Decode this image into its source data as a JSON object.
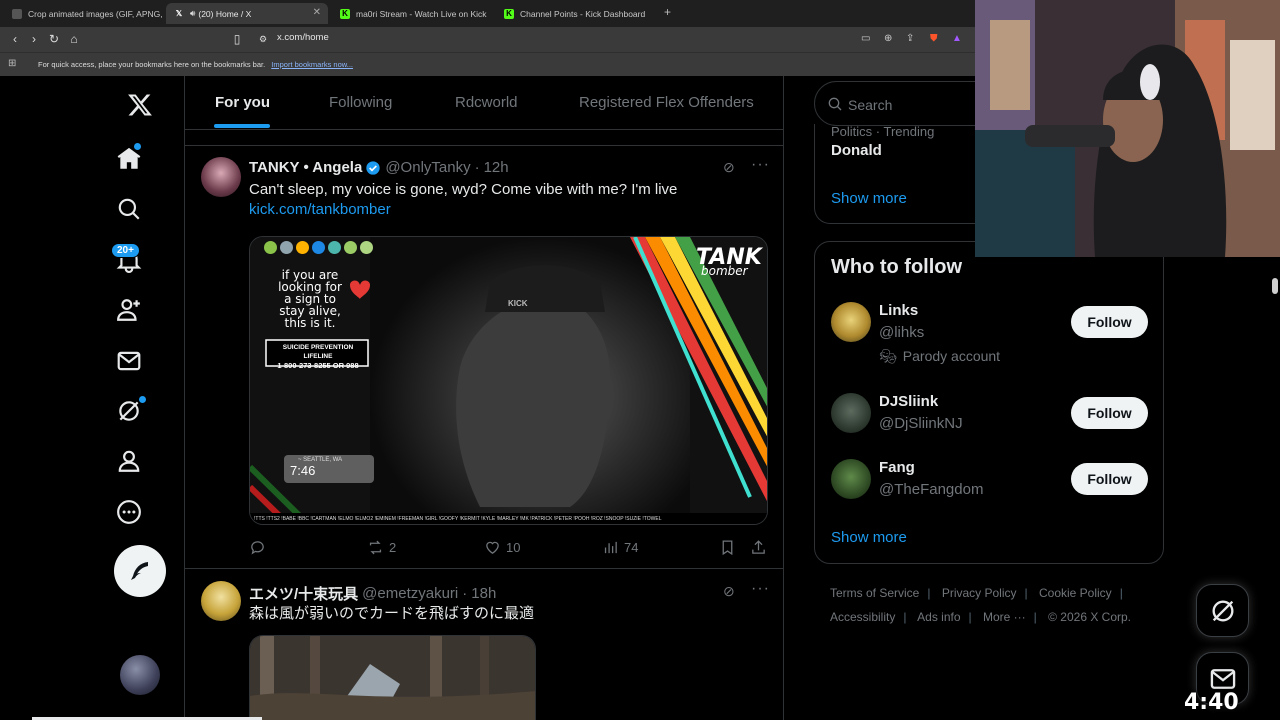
{
  "browser": {
    "tabs": [
      {
        "title": "Crop animated images (GIF, APNG, W",
        "icon": "crop-favicon"
      },
      {
        "title": "(20) Home / X",
        "icon": "x-favicon",
        "active": true
      },
      {
        "title": "ma0ri Stream - Watch Live on Kick",
        "icon": "kick-favicon"
      },
      {
        "title": "Channel Points - Kick Dashboard",
        "icon": "kick-favicon"
      }
    ],
    "url": "x.com/home",
    "bookmarks_text": "For quick access, place your bookmarks here on the bookmarks bar.",
    "bookmarks_link": "Import bookmarks now..."
  },
  "nav": {
    "notifications_badge": "20+"
  },
  "feed_tabs": [
    "For you",
    "Following",
    "Rdcworld",
    "Registered Flex Offenders"
  ],
  "tweets": [
    {
      "name": "TANKY • Angela",
      "handle": "@OnlyTanky",
      "time": "12h",
      "text": "Can't sleep, my voice is gone, wyd? Come vibe with me?  I'm live",
      "link": "kick.com/tankbomber",
      "media": {
        "brand_top": "TANK",
        "brand_bottom": "bomber",
        "overlay_lines": [
          "if you are",
          "looking for",
          "a sign to",
          "stay alive,",
          "this is it."
        ],
        "hotline_title": "SUICIDE PREVENTION LIFELINE",
        "hotline_number": "1-800-273-8255 OR 988",
        "clock_city": "~ SEATTLE, WA",
        "clock_time": "7:46",
        "cap_text": "KICK",
        "ticker": "!TTS !TTS2 !BABE !BBC !CARTMAN !ELMO !ELMO2 !EMINEM !FREEMAN !GIRL !GOOFY !KERMIT !KYLE !MARLEY !MK !PATRICK !PETER !POOH !ROZ !SNOOP !SUZIE !TOWEL"
      },
      "replies": "",
      "reposts": "2",
      "likes": "10",
      "views": "74"
    },
    {
      "name": "エメツ/十束玩具",
      "handle": "@emetzyakuri",
      "time": "18h",
      "text": "森は風が弱いのでカードを飛ばすのに最適"
    }
  ],
  "sidebar": {
    "search_placeholder": "Search",
    "trending_context": "Politics · Trending",
    "trending_topic": "Donald",
    "show_more": "Show more",
    "who_to_follow_title": "Who to follow",
    "who_to_follow": [
      {
        "name": "Links",
        "handle": "@lihks",
        "extra": "Parody account",
        "button": "Follow"
      },
      {
        "name": "DJSliink",
        "handle": "@DjSliinkNJ",
        "extra": "",
        "button": "Follow"
      },
      {
        "name": "Fang",
        "handle": "@TheFangdom",
        "extra": "",
        "button": "Follow"
      }
    ],
    "show_more_2": "Show more",
    "footer": [
      "Terms of Service",
      "Privacy Policy",
      "Cookie Policy",
      "Accessibility",
      "Ads info",
      "More ···",
      "© 2026 X Corp."
    ]
  },
  "overlay": {
    "clock": "4:40 pm"
  },
  "colors": {
    "accent": "#1d9bf0",
    "background": "#000000",
    "border": "#2f3336",
    "text_primary": "#e7e9ea",
    "text_secondary": "#71767b"
  }
}
